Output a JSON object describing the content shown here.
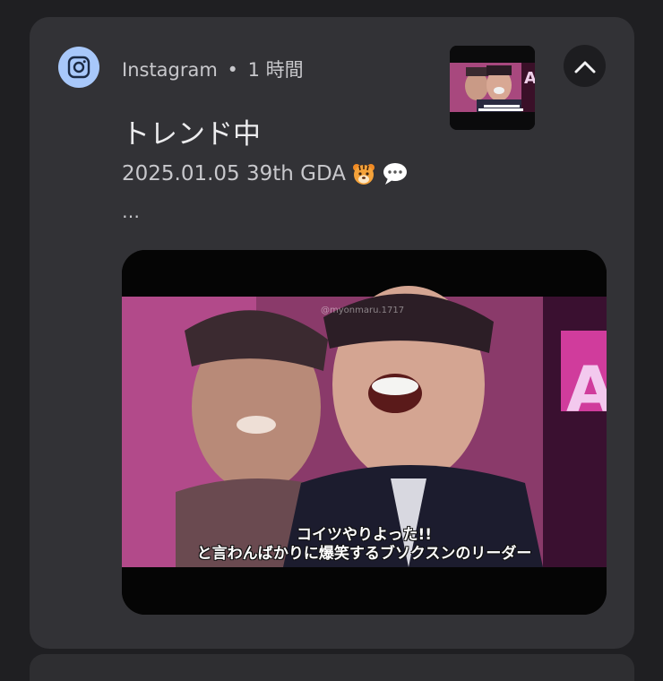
{
  "notification": {
    "app_name": "Instagram",
    "separator": "•",
    "time": "1 時間",
    "title": "トレンド中",
    "body": "2025.01.05 39th GDA",
    "body_emojis": [
      "tiger-face-emoji",
      "speech-bubble-emoji"
    ],
    "ellipsis": "…",
    "media": {
      "watermark": "@myonmaru.1717",
      "caption_line1": "コイツやりよった!!",
      "caption_line2": "と言わんばかりに爆笑するブソクスンのリーダー"
    }
  },
  "icons": {
    "app_icon": "instagram-icon",
    "collapse": "chevron-up-icon"
  },
  "colors": {
    "background": "#1f1f22",
    "card": "#323236",
    "app_icon_bg": "#a8c8fa"
  }
}
